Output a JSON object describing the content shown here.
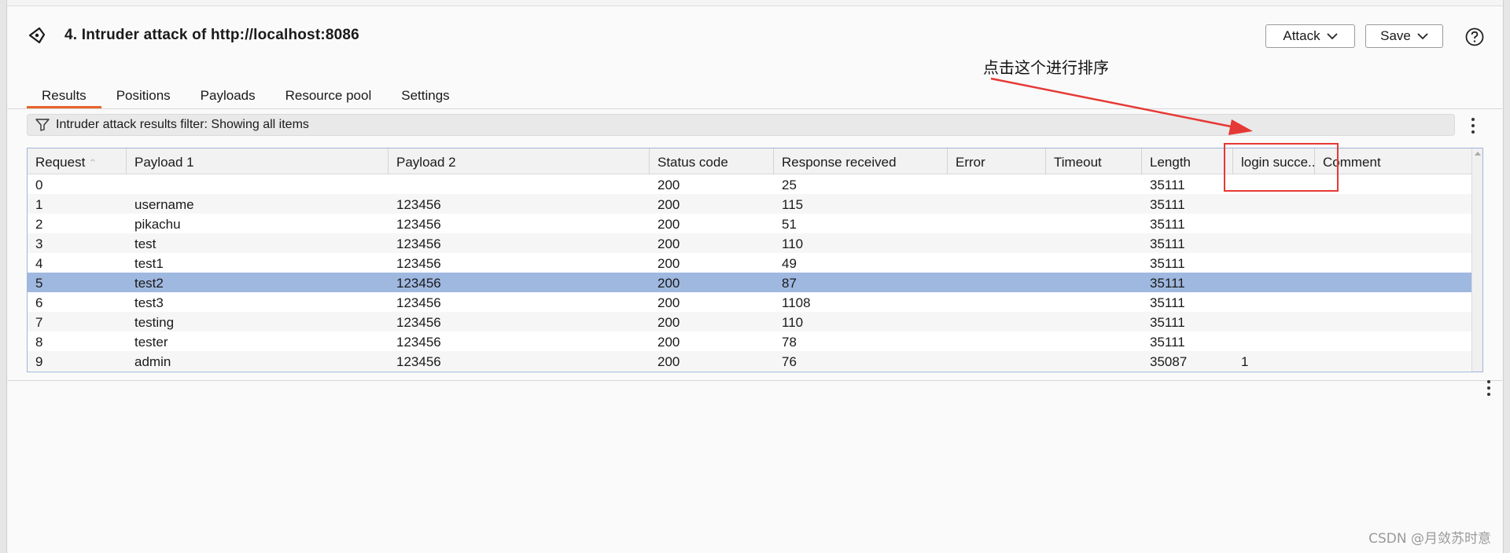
{
  "header": {
    "title": "4. Intruder attack of http://localhost:8086",
    "attack_label": "Attack",
    "save_label": "Save"
  },
  "tabs": [
    {
      "label": "Results",
      "active": true
    },
    {
      "label": "Positions"
    },
    {
      "label": "Payloads"
    },
    {
      "label": "Resource pool"
    },
    {
      "label": "Settings"
    }
  ],
  "filter": {
    "text": "Intruder attack results filter: Showing all items"
  },
  "table": {
    "columns": [
      "Request",
      "Payload 1",
      "Payload 2",
      "Status code",
      "Response received",
      "Error",
      "Timeout",
      "Length",
      "login succe...",
      "Comment"
    ],
    "sorted_column": "Request",
    "selected_row": 5,
    "rows": [
      [
        "0",
        "",
        "",
        "200",
        "25",
        "",
        "",
        "35111",
        "",
        ""
      ],
      [
        "1",
        "username",
        "123456",
        "200",
        "115",
        "",
        "",
        "35111",
        "",
        ""
      ],
      [
        "2",
        "pikachu",
        "123456",
        "200",
        "51",
        "",
        "",
        "35111",
        "",
        ""
      ],
      [
        "3",
        "test",
        "123456",
        "200",
        "110",
        "",
        "",
        "35111",
        "",
        ""
      ],
      [
        "4",
        "test1",
        "123456",
        "200",
        "49",
        "",
        "",
        "35111",
        "",
        ""
      ],
      [
        "5",
        "test2",
        "123456",
        "200",
        "87",
        "",
        "",
        "35111",
        "",
        ""
      ],
      [
        "6",
        "test3",
        "123456",
        "200",
        "1108",
        "",
        "",
        "35111",
        "",
        ""
      ],
      [
        "7",
        "testing",
        "123456",
        "200",
        "110",
        "",
        "",
        "35111",
        "",
        ""
      ],
      [
        "8",
        "tester",
        "123456",
        "200",
        "78",
        "",
        "",
        "35111",
        "",
        ""
      ],
      [
        "9",
        "admin",
        "123456",
        "200",
        "76",
        "",
        "",
        "35087",
        "1",
        ""
      ]
    ]
  },
  "annotation": {
    "text": "点击这个进行排序",
    "color": "#e53935"
  },
  "watermark": "CSDN @月敛苏时意",
  "colors": {
    "accent": "#e8622c",
    "selected_row": "#9fb8e0",
    "annotation": "#e53935"
  },
  "icons": {
    "app": "target-icon",
    "filter": "funnel-icon",
    "help": "help-icon",
    "menu": "more-vertical-icon"
  }
}
